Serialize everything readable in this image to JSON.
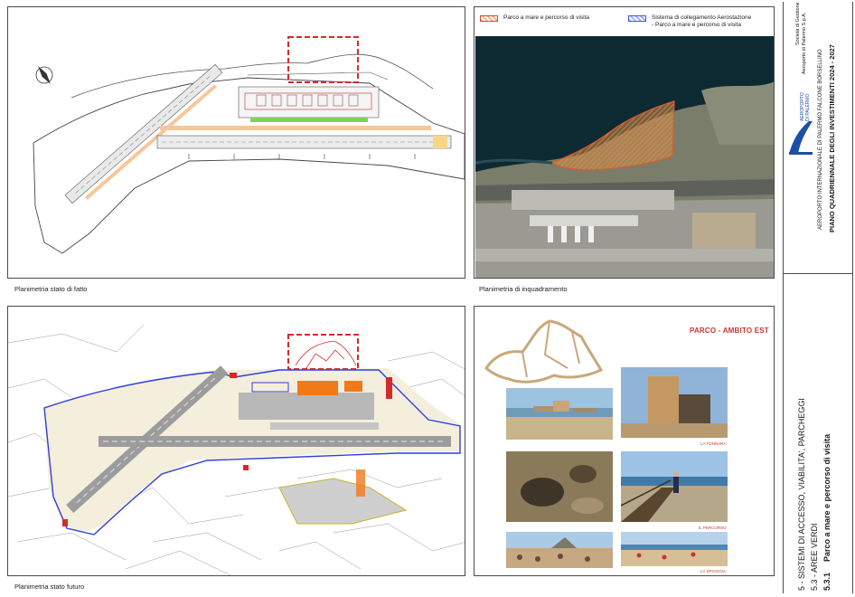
{
  "panels": {
    "top_left_caption": "Planimetria stato di fatto",
    "top_right_caption": "Planimetria di inquadramento",
    "bottom_left_caption": "Planimetria stato futuro"
  },
  "legend": {
    "item1": "Parco a mare e percorso di visita",
    "item2_line1": "Sistema di collegamento Aerostazione",
    "item2_line2": "- Parco a mare e percorso di visita"
  },
  "park": {
    "title": "PARCO - AMBITO EST",
    "captions": [
      "LA TONNARA",
      "IL PERCORSO",
      "LA SPIAGGIA"
    ]
  },
  "title_block": {
    "logo_line1": "AEROPORTO",
    "logo_line2": "DI PALERMO",
    "company_line1": "Società di Gestione",
    "company_line2": "Aeroporto di Palermo S.p.A.",
    "airport": "AEROPORTO INTERNAZIONALE DI PALERMO FALCONE BORSELLINO",
    "plan": "PIANO QUADRIENNALE DEGLI INVESTIMENTI 2024 - 2027",
    "section": "5 - SISTEMI DI ACCESSO, VIABILITA', PARCHEGGI",
    "subsection": "5.3 - AREE VERDI",
    "item_number": "5.3.1",
    "item_title": "Parco a mare e percorso di visita"
  },
  "colors": {
    "red": "#d62a2a",
    "blue": "#2f3fd8",
    "orange": "#f07a1a",
    "beige": "#f4eedd",
    "sea": "#0e2a35",
    "logo_blue": "#1d4fa6"
  }
}
